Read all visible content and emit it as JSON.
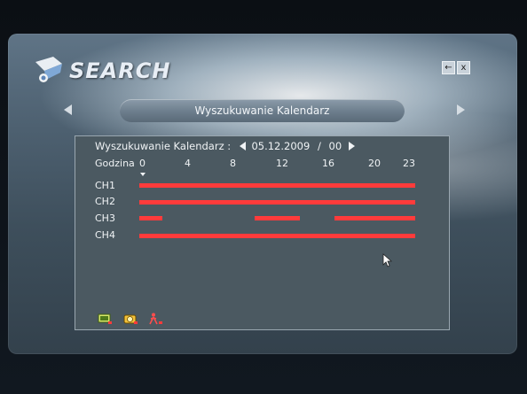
{
  "window": {
    "title": "SEARCH",
    "close_label": "x",
    "back_label": "←"
  },
  "nav": {
    "label": "Wyszukuwanie Kalendarz"
  },
  "calendar": {
    "header_label": "Wyszukuwanie Kalendarz :",
    "date": "05.12.2009",
    "separator": "/",
    "hour": "00",
    "hour_label": "Godzina",
    "ticks": [
      "0",
      "4",
      "8",
      "12",
      "16",
      "20",
      "23"
    ],
    "channels": [
      {
        "name": "CH1",
        "recordings": [
          [
            0,
            24
          ]
        ]
      },
      {
        "name": "CH2",
        "recordings": [
          [
            0,
            24
          ]
        ]
      },
      {
        "name": "CH3",
        "recordings": [
          [
            0,
            2
          ],
          [
            10,
            14
          ],
          [
            17,
            24
          ]
        ]
      },
      {
        "name": "CH4",
        "recordings": [
          [
            0,
            24
          ]
        ]
      }
    ]
  },
  "colors": {
    "record_bar": "#ff3b3b",
    "text": "#f0f3f5"
  },
  "icons": [
    "monitor-icon",
    "alarm-icon",
    "motion-icon"
  ]
}
